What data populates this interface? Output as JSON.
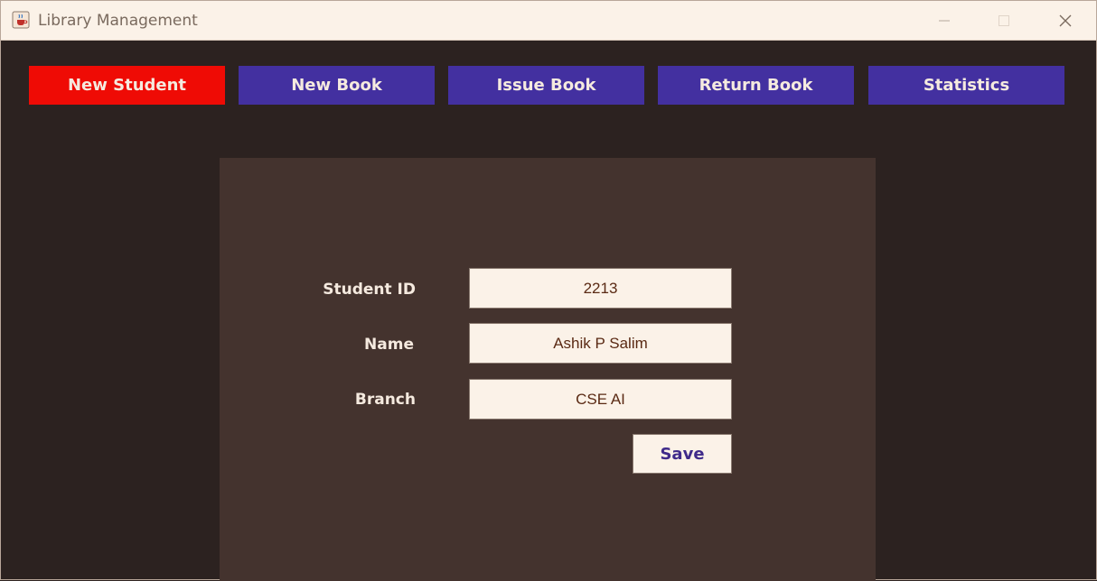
{
  "window": {
    "title": "Library Management",
    "icon": "java-cup-icon",
    "controls": [
      "minimize-icon",
      "maximize-icon",
      "close-icon"
    ]
  },
  "nav": {
    "items": [
      {
        "label": "New Student",
        "active": true
      },
      {
        "label": "New Book",
        "active": false
      },
      {
        "label": "Issue Book",
        "active": false
      },
      {
        "label": "Return Book",
        "active": false
      },
      {
        "label": "Statistics",
        "active": false
      }
    ]
  },
  "form": {
    "student_id_label": "Student ID",
    "student_id_value": "2213",
    "name_label": "Name",
    "name_value": "Ashik P Salim",
    "branch_label": "Branch",
    "branch_value": "CSE AI",
    "save_label": "Save"
  },
  "colors": {
    "background": "#2c2220",
    "panel": "#44332e",
    "nav_active": "#ef0b05",
    "nav_default": "#4330a0",
    "input_bg": "#fbf2e8",
    "save_text": "#3f2a8a"
  }
}
